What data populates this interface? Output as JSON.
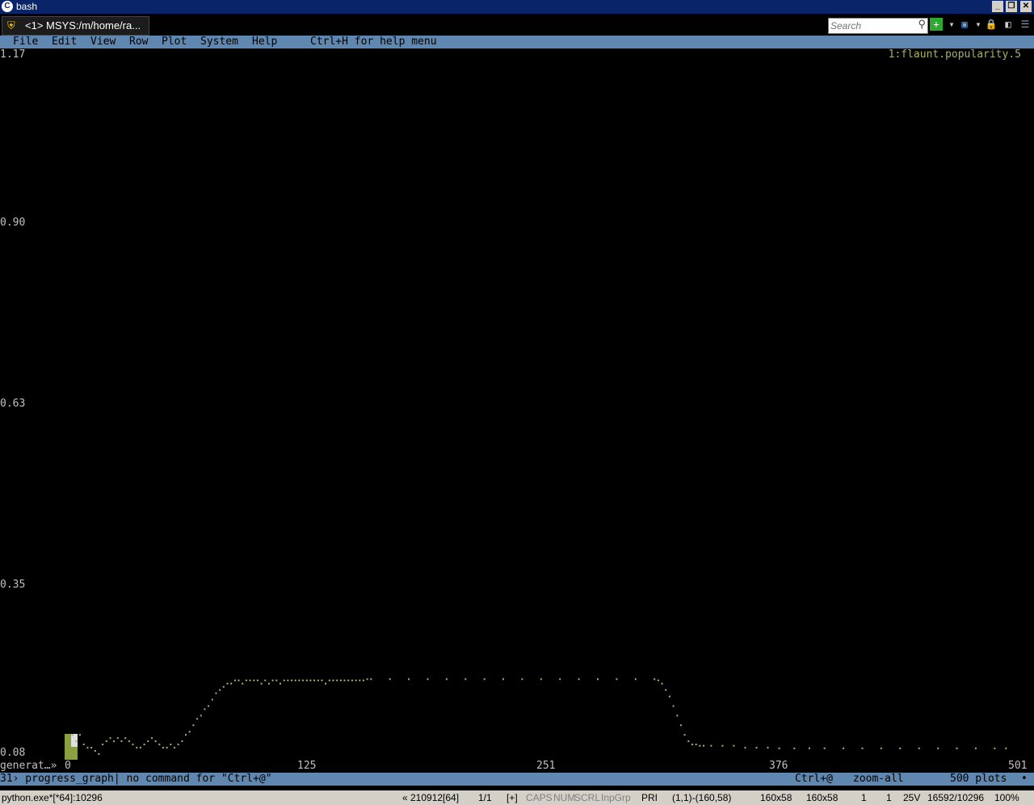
{
  "window": {
    "title": "bash",
    "controls": {
      "minimize": "_",
      "restore": "❐",
      "close": "✕"
    }
  },
  "tab": {
    "label": "<1> MSYS:/m/home/ra..."
  },
  "search": {
    "placeholder": "Search"
  },
  "menu": {
    "items": [
      "File",
      "Edit",
      "View",
      "Row",
      "Plot",
      "System",
      "Help"
    ],
    "hint": "Ctrl+H for help menu"
  },
  "plot": {
    "legend": "1:flaunt.popularity.5",
    "column_name": "generat…»",
    "color": "#a9b166"
  },
  "chart_data": {
    "type": "scatter",
    "ylabels": [
      "1.17",
      "0.90",
      "0.63",
      "0.35",
      "0.08"
    ],
    "xlabels": [
      "0",
      "125",
      "251",
      "376",
      "501"
    ],
    "ylim": [
      0.08,
      1.17
    ],
    "xlim": [
      0,
      501
    ],
    "series": [
      {
        "points": [
          [
            2,
            0.11
          ],
          [
            4,
            0.1
          ],
          [
            6,
            0.11
          ],
          [
            8,
            0.095
          ],
          [
            10,
            0.09
          ],
          [
            12,
            0.09
          ],
          [
            14,
            0.085
          ],
          [
            16,
            0.08
          ],
          [
            18,
            0.095
          ],
          [
            20,
            0.1
          ],
          [
            22,
            0.105
          ],
          [
            24,
            0.1
          ],
          [
            26,
            0.105
          ],
          [
            28,
            0.1
          ],
          [
            30,
            0.105
          ],
          [
            32,
            0.1
          ],
          [
            34,
            0.095
          ],
          [
            36,
            0.09
          ],
          [
            38,
            0.09
          ],
          [
            40,
            0.095
          ],
          [
            42,
            0.1
          ],
          [
            44,
            0.105
          ],
          [
            46,
            0.1
          ],
          [
            48,
            0.095
          ],
          [
            50,
            0.09
          ],
          [
            52,
            0.09
          ],
          [
            54,
            0.095
          ],
          [
            56,
            0.09
          ],
          [
            58,
            0.095
          ],
          [
            60,
            0.1
          ],
          [
            62,
            0.11
          ],
          [
            64,
            0.115
          ],
          [
            66,
            0.125
          ],
          [
            68,
            0.135
          ],
          [
            70,
            0.14
          ],
          [
            72,
            0.15
          ],
          [
            74,
            0.155
          ],
          [
            76,
            0.165
          ],
          [
            78,
            0.175
          ],
          [
            80,
            0.18
          ],
          [
            82,
            0.185
          ],
          [
            84,
            0.19
          ],
          [
            86,
            0.19
          ],
          [
            88,
            0.195
          ],
          [
            90,
            0.195
          ],
          [
            92,
            0.19
          ],
          [
            94,
            0.195
          ],
          [
            96,
            0.195
          ],
          [
            98,
            0.195
          ],
          [
            100,
            0.195
          ],
          [
            102,
            0.19
          ],
          [
            104,
            0.195
          ],
          [
            106,
            0.19
          ],
          [
            108,
            0.195
          ],
          [
            110,
            0.195
          ],
          [
            112,
            0.19
          ],
          [
            114,
            0.195
          ],
          [
            116,
            0.195
          ],
          [
            118,
            0.195
          ],
          [
            120,
            0.195
          ],
          [
            122,
            0.195
          ],
          [
            124,
            0.195
          ],
          [
            126,
            0.195
          ],
          [
            128,
            0.195
          ],
          [
            130,
            0.195
          ],
          [
            132,
            0.195
          ],
          [
            134,
            0.195
          ],
          [
            136,
            0.19
          ],
          [
            138,
            0.195
          ],
          [
            140,
            0.195
          ],
          [
            142,
            0.195
          ],
          [
            144,
            0.195
          ],
          [
            146,
            0.195
          ],
          [
            148,
            0.195
          ],
          [
            150,
            0.195
          ],
          [
            152,
            0.195
          ],
          [
            154,
            0.195
          ],
          [
            156,
            0.195
          ],
          [
            158,
            0.197
          ],
          [
            160,
            0.197
          ],
          [
            170,
            0.197
          ],
          [
            180,
            0.197
          ],
          [
            190,
            0.197
          ],
          [
            200,
            0.197
          ],
          [
            210,
            0.197
          ],
          [
            220,
            0.197
          ],
          [
            230,
            0.197
          ],
          [
            240,
            0.197
          ],
          [
            250,
            0.197
          ],
          [
            260,
            0.197
          ],
          [
            270,
            0.197
          ],
          [
            280,
            0.197
          ],
          [
            290,
            0.197
          ],
          [
            300,
            0.197
          ],
          [
            310,
            0.197
          ],
          [
            312,
            0.195
          ],
          [
            314,
            0.19
          ],
          [
            316,
            0.18
          ],
          [
            318,
            0.17
          ],
          [
            320,
            0.155
          ],
          [
            322,
            0.14
          ],
          [
            324,
            0.125
          ],
          [
            326,
            0.11
          ],
          [
            328,
            0.1
          ],
          [
            330,
            0.095
          ],
          [
            332,
            0.095
          ],
          [
            334,
            0.093
          ],
          [
            336,
            0.093
          ],
          [
            340,
            0.093
          ],
          [
            346,
            0.093
          ],
          [
            352,
            0.093
          ],
          [
            358,
            0.09
          ],
          [
            364,
            0.09
          ],
          [
            370,
            0.09
          ],
          [
            376,
            0.089
          ],
          [
            384,
            0.089
          ],
          [
            392,
            0.089
          ],
          [
            400,
            0.089
          ],
          [
            410,
            0.089
          ],
          [
            420,
            0.089
          ],
          [
            430,
            0.089
          ],
          [
            440,
            0.089
          ],
          [
            450,
            0.089
          ],
          [
            460,
            0.089
          ],
          [
            470,
            0.089
          ],
          [
            480,
            0.089
          ],
          [
            490,
            0.089
          ],
          [
            496,
            0.089
          ]
        ]
      }
    ]
  },
  "statusbar": {
    "left": "31› progress_graph| no command for \"Ctrl+@\"",
    "key": "Ctrl+@",
    "cmd": "zoom-all",
    "plots": "500 plots",
    "dot": "•"
  },
  "win_status": {
    "process": "python.exe*[*64]:10296",
    "buffer": "« 210912[64]",
    "pages": "1/1",
    "plus": "[+]",
    "caps": "CAPS",
    "num": "NUM",
    "scrl": "SCRL",
    "inpgrp": "InpGrp",
    "pri": "PRI",
    "range": "(1,1)-(160,58)",
    "size1": "160x58",
    "size2": "160x58",
    "n1": "1",
    "n2": "1",
    "v": "25V",
    "mem": "16592/10296",
    "zoom": "100%"
  }
}
